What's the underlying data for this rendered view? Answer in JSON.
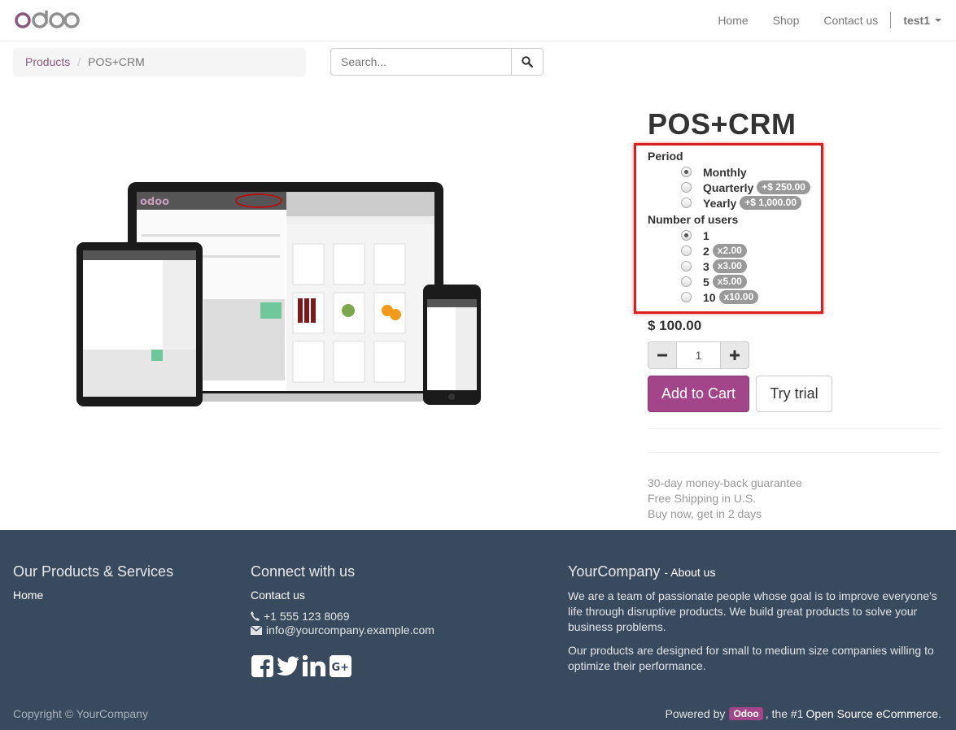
{
  "navbar": {
    "logo_text": "odoo",
    "links": [
      "Home",
      "Shop",
      "Contact us"
    ],
    "user": "test1"
  },
  "breadcrumb": {
    "parent": "Products",
    "current": "POS+CRM"
  },
  "search": {
    "placeholder": "Search..."
  },
  "product": {
    "title": "POS+CRM",
    "period_label": "Period",
    "period_options": [
      {
        "label": "Monthly",
        "extra": "",
        "checked": true
      },
      {
        "label": "Quarterly",
        "extra": "+$ 250.00",
        "checked": false
      },
      {
        "label": "Yearly",
        "extra": "+$ 1,000.00",
        "checked": false
      }
    ],
    "users_label": "Number of users",
    "users_options": [
      {
        "label": "1",
        "extra": "",
        "checked": true
      },
      {
        "label": "2",
        "extra": "x2.00",
        "checked": false
      },
      {
        "label": "3",
        "extra": "x3.00",
        "checked": false
      },
      {
        "label": "5",
        "extra": "x5.00",
        "checked": false
      },
      {
        "label": "10",
        "extra": "x10.00",
        "checked": false
      }
    ],
    "price": "$ 100.00",
    "quantity": "1",
    "add_to_cart": "Add to Cart",
    "try_trial": "Try trial",
    "guarantees": [
      "30-day money-back guarantee",
      "Free Shipping in U.S.",
      "Buy now, get in 2 days"
    ]
  },
  "footer": {
    "products_title": "Our Products & Services",
    "products_links": [
      "Home"
    ],
    "connect_title": "Connect with us",
    "contact_link": "Contact us",
    "phone": "+1 555 123 8069",
    "email": "info@yourcompany.example.com",
    "company_title": "YourCompany",
    "about_link": "About us",
    "about_text_1": "We are a team of passionate people whose goal is to improve everyone's life through disruptive products. We build great products to solve your business problems.",
    "about_text_2": "Our products are designed for small to medium size companies willing to optimize their performance.",
    "copyright": "Copyright © YourCompany",
    "powered_prefix": "Powered by",
    "powered_badge": "Odoo",
    "powered_middle": ", the #1",
    "powered_link": "Open Source eCommerce",
    "powered_suffix": "."
  },
  "colors": {
    "brand": "#875a7b",
    "primary_button": "#a24689",
    "footer_bg": "#3a4a5e",
    "highlight_border": "#d9201f"
  }
}
